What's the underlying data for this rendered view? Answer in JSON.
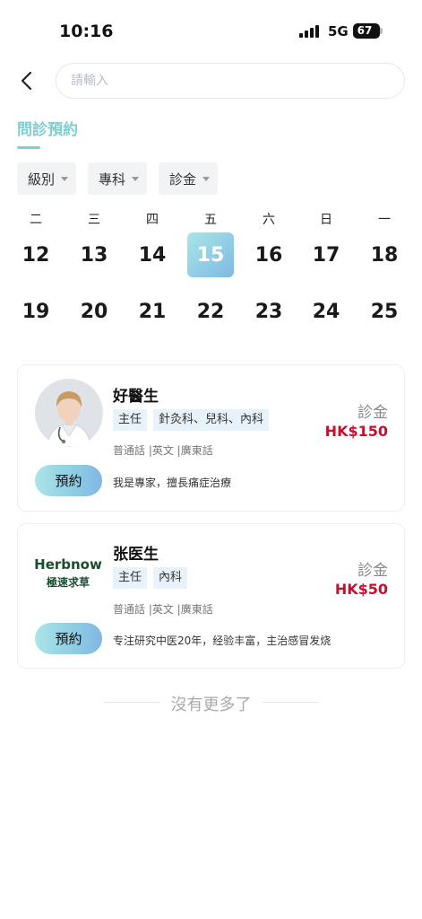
{
  "status_bar": {
    "time": "10:16",
    "network": "5G",
    "battery": "67"
  },
  "search": {
    "placeholder": "請輸入"
  },
  "tab": {
    "label": "問診預約"
  },
  "filters": [
    {
      "label": "級別"
    },
    {
      "label": "專科"
    },
    {
      "label": "診金"
    }
  ],
  "calendar": {
    "weekdays": [
      "二",
      "三",
      "四",
      "五",
      "六",
      "日",
      "一"
    ],
    "week1": [
      "12",
      "13",
      "14",
      "15",
      "16",
      "17",
      "18"
    ],
    "week2": [
      "19",
      "20",
      "21",
      "22",
      "23",
      "24",
      "25"
    ],
    "selected": "15"
  },
  "doctors": [
    {
      "name": "好醫生",
      "title_tag": "主任",
      "dept_tag": "針灸科、兒科、內科",
      "languages": "普通話 |英文 |廣東話",
      "fee_label": "診金",
      "fee": "HK$150",
      "book_label": "預約",
      "description": "我是專家，擅長痛症治療"
    },
    {
      "name": "张医生",
      "title_tag": "主任",
      "dept_tag": "內科",
      "languages": "普通話 |英文 |廣東話",
      "fee_label": "診金",
      "fee": "HK$50",
      "book_label": "預約",
      "description": "专注研究中医20年，经验丰富，主治感冒发烧",
      "logo_top": "Herbnow",
      "logo_bottom": "極速求草"
    }
  ],
  "footer": {
    "no_more": "沒有更多了"
  }
}
